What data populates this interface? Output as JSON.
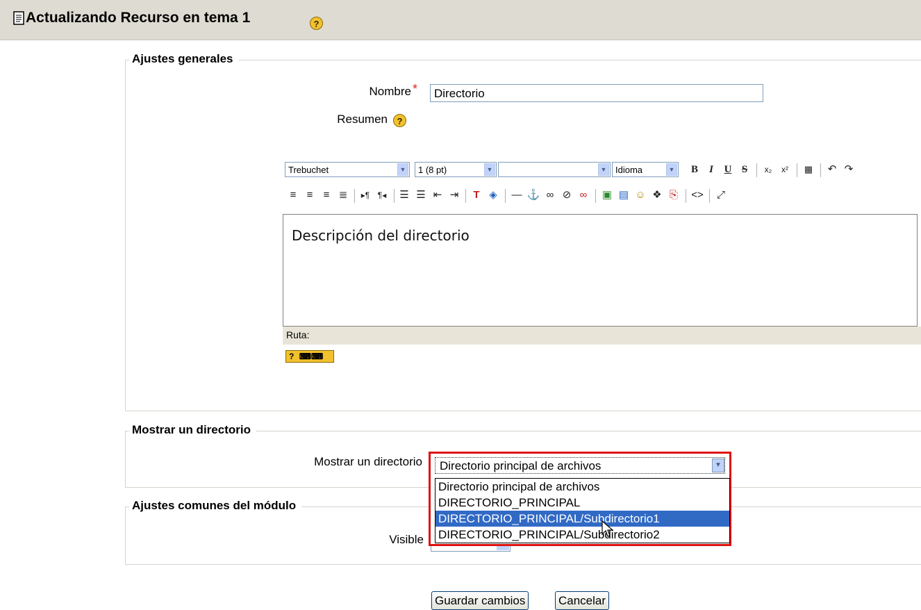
{
  "header": {
    "title": "Actualizando Recurso en tema 1",
    "help": "?"
  },
  "general": {
    "legend": "Ajustes generales",
    "name_label": "Nombre",
    "required_mark": "*",
    "name_value": "Directorio",
    "summary_label": "Resumen",
    "help": "?"
  },
  "editor": {
    "font": "Trebuchet",
    "size": "1 (8 pt)",
    "format": "",
    "lang": "Idioma",
    "content": "Descripción del directorio",
    "path_label": "Ruta:",
    "kbd_help": "?"
  },
  "directory": {
    "legend": "Mostrar un directorio",
    "label": "Mostrar un directorio",
    "selected": "Directorio principal de archivos",
    "options": [
      "Directorio principal de archivos",
      "DIRECTORIO_PRINCIPAL",
      "DIRECTORIO_PRINCIPAL/Subdirectorio1",
      "DIRECTORIO_PRINCIPAL/Subdirectorio2"
    ],
    "highlighted_index": 2
  },
  "common": {
    "legend": "Ajustes comunes del módulo",
    "visible_label": "Visible"
  },
  "buttons": {
    "save": "Guardar cambios",
    "cancel": "Cancelar"
  },
  "colors": {
    "highlight": "#e01010",
    "selection": "#316ac5",
    "header_bg": "#dedbd2"
  }
}
